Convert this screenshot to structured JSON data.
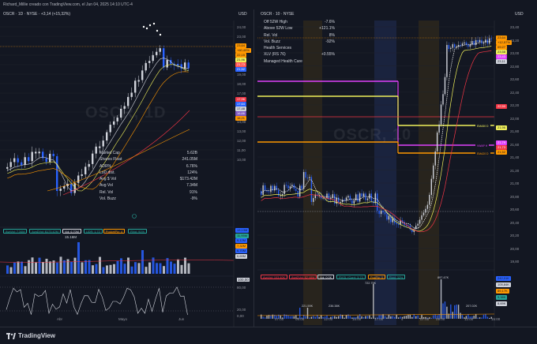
{
  "header": {
    "caption": "Richard_Millie creado con TradingView.com, el Jun 04, 2025 14:10 UTC-4"
  },
  "left_chart": {
    "title": "OSCR · 1D · NYSE · +3,14 (+15,32%)",
    "currency": "USD",
    "watermark": "OSCR, 1D",
    "price_ticks": [
      "24,00",
      "23,00",
      "22,00",
      "21,00",
      "20,00",
      "19,00",
      "18,00",
      "17,00",
      "16,00",
      "15,00",
      "14,00",
      "13,00",
      "12,00",
      "11,00",
      "10,00"
    ],
    "price_labels": [
      {
        "text": "23,64",
        "color": "#ff9800",
        "fg": "#131722"
      },
      {
        "text": "+60,49%",
        "color": "#ff9800",
        "fg": "#131722"
      },
      {
        "text": "22,15",
        "color": "#ff9800",
        "fg": "#131722"
      },
      {
        "text": "21,96",
        "color": "#f0f05a",
        "fg": "#131722"
      },
      {
        "text": "21,73",
        "color": "#ff5252",
        "fg": "#ffffff"
      },
      {
        "text": "21,52",
        "color": "#2962ff",
        "fg": "#ffffff"
      },
      {
        "text": "17,96",
        "color": "#f23645",
        "fg": "#ffffff"
      },
      {
        "text": "17,64",
        "color": "#2962ff",
        "fg": "#ffffff"
      },
      {
        "text": "17,48",
        "color": "#d1d4dc",
        "fg": "#131722"
      },
      {
        "text": "16,66",
        "color": "#7e57c2",
        "fg": "#ffffff"
      },
      {
        "text": "16,21",
        "color": "#ff9800",
        "fg": "#131722"
      }
    ],
    "stats": [
      {
        "k": "Market Cap",
        "v": "5.62B"
      },
      {
        "k": "Shares Float",
        "v": "241.05M"
      },
      {
        "k": "ADR%",
        "v": "6.76%"
      },
      {
        "k": "LoD dist.",
        "v": "124%"
      },
      {
        "k": "Avg $ Vol",
        "v": "$173.42M"
      },
      {
        "k": "Avg Vol",
        "v": "7.34M"
      },
      {
        "k": "Rel. Vol",
        "v": "91%"
      },
      {
        "k": "Vol. Buzz",
        "v": "-9%"
      }
    ],
    "volume_chips": [
      {
        "text": "AvgVol: 7.34M",
        "color": "#26a69a"
      },
      {
        "text": "AvgDVol: $173.42M",
        "color": "#26a69a"
      },
      {
        "text": "Vol: 6.70M",
        "color": "#d1d4dc"
      },
      {
        "text": "UDR: 1.72",
        "color": "#26a69a"
      },
      {
        "text": "PocketPiv: 4",
        "color": "#ff9800"
      },
      {
        "text": "RVol: 91%",
        "color": "#26a69a"
      }
    ],
    "volume_peak_label": "15.16M",
    "volume_labels": [
      {
        "text": "13,13M",
        "color": "#2962ff"
      },
      {
        "text": "11,95M",
        "color": "#26a69a"
      },
      {
        "text": "9,12M",
        "color": "#2962ff"
      },
      {
        "text": "7,32M",
        "color": "#ff9800"
      },
      {
        "text": "6,70M",
        "color": "#2962ff"
      },
      {
        "text": "0,69M",
        "color": "#d1d4dc"
      }
    ],
    "osc_ticks": [
      "100,00",
      "80,00",
      "20,00",
      "0,00"
    ],
    "dates": [
      "Abr",
      "Mayo",
      "Jun"
    ]
  },
  "right_chart": {
    "title": "OSCR · 10 · NYSE",
    "currency": "USD",
    "watermark": "OSCR, 10",
    "stats": [
      {
        "k": "Off 52W High",
        "v": "-7.6%"
      },
      {
        "k": "Above 52W Low",
        "v": "+121.1%"
      },
      {
        "k": "Rel. Vol",
        "v": "8%"
      },
      {
        "k": "Vol. Buzz",
        "v": "-92%"
      },
      {
        "k": "Health Services",
        "v": ""
      },
      {
        "k": "XLV (RS 76)",
        "v": "+0.55%"
      },
      {
        "k": "Managed Health Care",
        "v": ""
      }
    ],
    "price_ticks": [
      "23,40",
      "23,20",
      "23,00",
      "22,80",
      "22,60",
      "22,40",
      "22,20",
      "22,00",
      "21,80",
      "21,60",
      "21,40",
      "21,20",
      "21,00",
      "20,80",
      "20,60",
      "20,40",
      "20,20",
      "20,00",
      "19,80"
    ],
    "price_labels": [
      {
        "text": "23,64",
        "color": "#ff9800",
        "fg": "#131722"
      },
      {
        "text": "+12,57%",
        "color": "#ff9800",
        "fg": "#131722"
      },
      {
        "text": "09:27",
        "color": "#ff9800",
        "fg": "#131722"
      },
      {
        "text": "23,58",
        "color": "#f0f05a",
        "fg": "#131722"
      },
      {
        "text": "23,43",
        "color": "#e040fb",
        "fg": "#ffffff"
      },
      {
        "text": "23,11",
        "color": "#d1d4dc",
        "fg": "#131722"
      },
      {
        "text": "22,50",
        "color": "#f23645",
        "fg": "#ffffff"
      },
      {
        "text": "21,96",
        "color": "#f0f05a",
        "fg": "#131722"
      },
      {
        "text": "21,79",
        "color": "#e040fb",
        "fg": "#ffffff"
      },
      {
        "text": "21,73",
        "color": "#f23645",
        "fg": "#ffffff"
      },
      {
        "text": "21,52",
        "color": "#ff9800",
        "fg": "#131722"
      }
    ],
    "line_tags": [
      {
        "text": "EMA50 D",
        "color": "#f0f05a"
      },
      {
        "text": "VWAP H",
        "color": "#e040fb"
      },
      {
        "text": "EMA20 D",
        "color": "#ff9800"
      }
    ],
    "volume_chips": [
      {
        "text": "AvgVol: 103.40K",
        "color": "#f23645"
      },
      {
        "text": "AvgDVol: $2.48M",
        "color": "#f23645"
      },
      {
        "text": "Vol: 0.0K",
        "color": "#d1d4dc"
      },
      {
        "text": "RVOL (Curr): 3.73",
        "color": "#26a69a"
      },
      {
        "text": "PocPiv: 0",
        "color": "#ff9800"
      },
      {
        "text": "Rvol: 32%",
        "color": "#26a69a"
      }
    ],
    "vol_peak_labels": [
      "221.59K",
      "236.38K",
      "722.75K",
      "897.47K",
      "207.02K"
    ],
    "volume_labels": [
      {
        "text": "242,01K",
        "color": "#2962ff"
      },
      {
        "text": "105,84K",
        "color": "#d1d4dc"
      },
      {
        "text": "89,17K",
        "color": "#ff9800"
      },
      {
        "text": "9,38K",
        "color": "#26a69a"
      },
      {
        "text": "8,69K",
        "color": "#d1d4dc"
      }
    ],
    "times": [
      "07:00",
      "09:00",
      "12:00",
      "15:00",
      "17:00",
      "4",
      "07:00",
      "09:00",
      "12:00",
      "15:00"
    ]
  },
  "footer": {
    "brand": "TradingView"
  }
}
